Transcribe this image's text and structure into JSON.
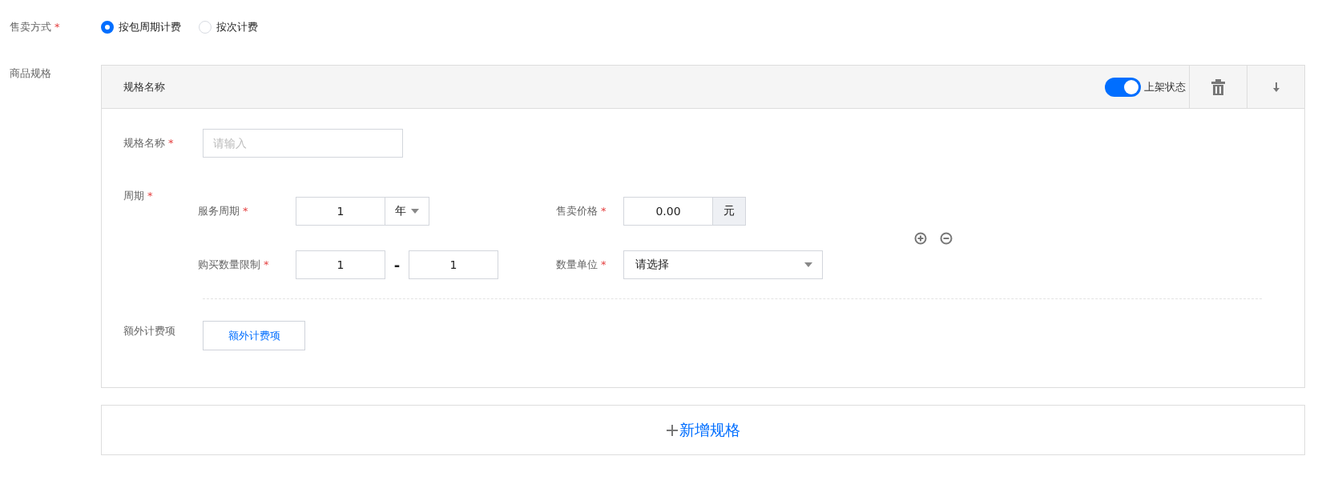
{
  "sale_method": {
    "label": "售卖方式",
    "mark": "*",
    "options": [
      {
        "label": "按包周期计费",
        "selected": true
      },
      {
        "label": "按次计费",
        "selected": false
      }
    ]
  },
  "specs": {
    "label": "商品规格",
    "items": [
      {
        "title": "规格名称",
        "listing": {
          "label": "上架状态",
          "on": true
        },
        "name_field": {
          "label": "规格名称",
          "mark": "*",
          "placeholder": "请输入"
        },
        "period": {
          "label": "周期",
          "mark": "*",
          "rows": [
            [
              {
                "kind": "number_select",
                "label": "服务周期",
                "mark": "*",
                "value": "1",
                "unit": "年"
              },
              {
                "kind": "addon",
                "label": "售卖价格",
                "mark": "*",
                "value": "0.00",
                "addon": "元"
              }
            ],
            [
              {
                "kind": "range",
                "label": "购买数量限制",
                "mark": "*",
                "from": "1",
                "separator": "-",
                "to": "1"
              },
              {
                "kind": "select",
                "label": "数量单位",
                "mark": "*",
                "value": "请选择"
              }
            ]
          ]
        },
        "extras": {
          "label": "额外计费项",
          "button": "额外计费项"
        }
      }
    ],
    "add_button": "新增规格"
  }
}
